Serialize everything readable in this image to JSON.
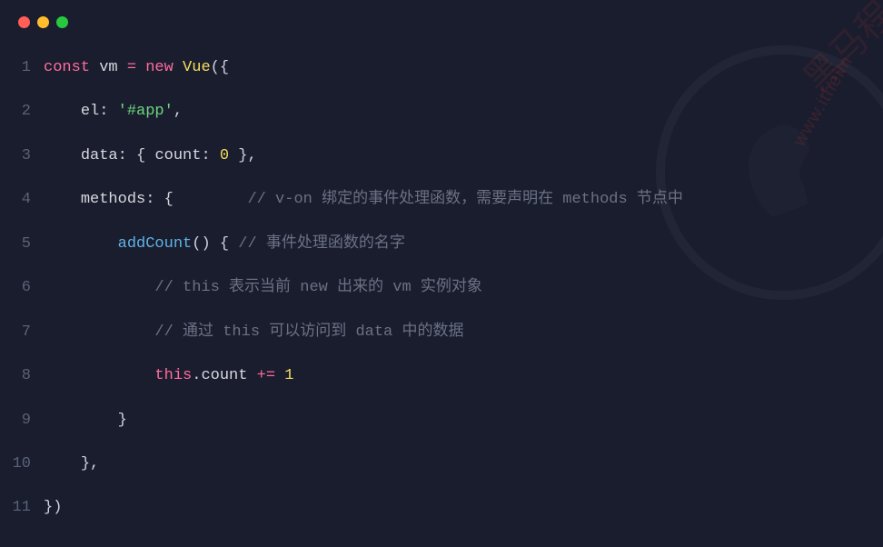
{
  "window": {
    "dots": [
      "red",
      "yellow",
      "green"
    ]
  },
  "code": {
    "lines": [
      {
        "n": "1"
      },
      {
        "n": "2"
      },
      {
        "n": "3"
      },
      {
        "n": "4"
      },
      {
        "n": "5"
      },
      {
        "n": "6"
      },
      {
        "n": "7"
      },
      {
        "n": "8"
      },
      {
        "n": "9"
      },
      {
        "n": "10"
      },
      {
        "n": "11"
      }
    ],
    "tokens": {
      "l1_const": "const",
      "l1_vm": "vm",
      "l1_eq": " = ",
      "l1_new": "new",
      "l1_vue": "Vue",
      "l1_open": "({",
      "l2_indent": "    ",
      "l2_el": "el",
      "l2_colon": ": ",
      "l2_app": "'#app'",
      "l2_comma": ",",
      "l3_indent": "    ",
      "l3_data": "data",
      "l3_colon": ": { ",
      "l3_count": "count",
      "l3_colon2": ": ",
      "l3_zero": "0",
      "l3_close": " },",
      "l4_indent": "    ",
      "l4_methods": "methods",
      "l4_colon": ": {        ",
      "l4_cmt": "// v-on 绑定的事件处理函数，需要声明在 methods 节点中",
      "l5_indent": "        ",
      "l5_fn": "addCount",
      "l5_paren": "() { ",
      "l5_cmt": "// 事件处理函数的名字",
      "l6_indent": "            ",
      "l6_cmt": "// this 表示当前 new 出来的 vm 实例对象",
      "l7_indent": "            ",
      "l7_cmt": "// 通过 this 可以访问到 data 中的数据",
      "l8_indent": "            ",
      "l8_this": "this",
      "l8_dot": ".",
      "l8_count": "count",
      "l8_op": " += ",
      "l8_one": "1",
      "l9_indent": "        ",
      "l9_close": "}",
      "l10_indent": "    ",
      "l10_close": "},",
      "l11_close": "})"
    }
  },
  "watermark": {
    "brand": "黑马程",
    "url": "www.itheim"
  }
}
